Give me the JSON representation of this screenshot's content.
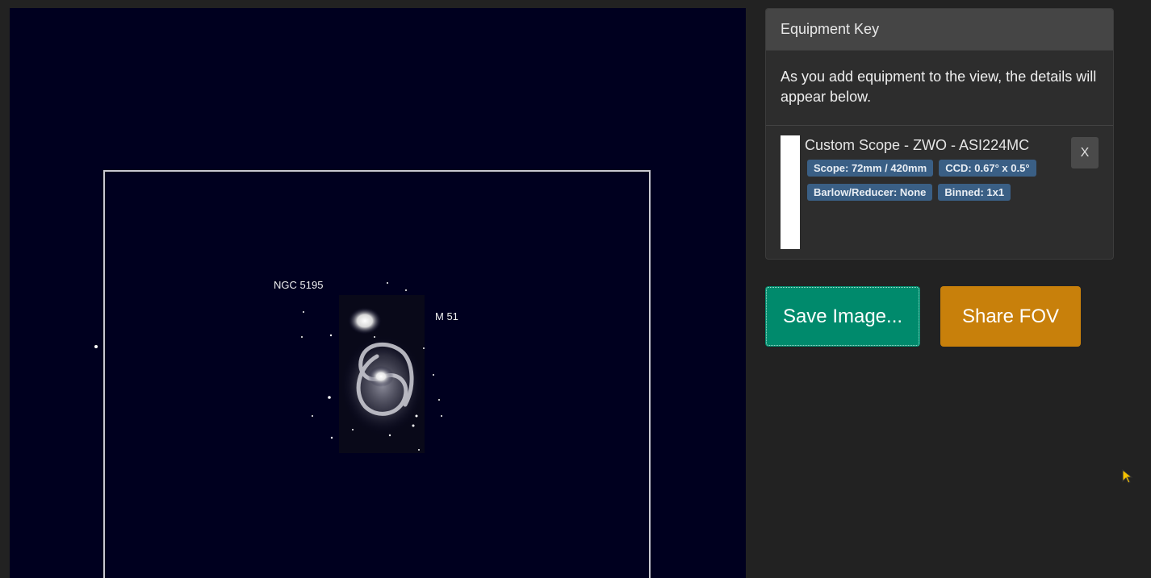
{
  "viewer": {
    "objects": [
      {
        "label": "NGC 5195"
      },
      {
        "label": "M 51"
      }
    ]
  },
  "equipment_key": {
    "title": "Equipment Key",
    "description": "As you add equipment to the view, the details will appear below.",
    "items": [
      {
        "name": "Custom Scope - ZWO - ASI224MC",
        "swatch_color": "#ffffff",
        "tags": [
          "Scope: 72mm / 420mm",
          "CCD: 0.67° x 0.5°",
          "Barlow/Reducer: None",
          "Binned: 1x1"
        ],
        "remove_label": "X"
      }
    ]
  },
  "actions": {
    "save_label": "Save Image...",
    "share_label": "Share FOV"
  },
  "colors": {
    "background": "#222222",
    "viewer_bg": "#00001f",
    "save": "#008a6c",
    "share": "#c8800b",
    "tag": "#3a5f85"
  }
}
